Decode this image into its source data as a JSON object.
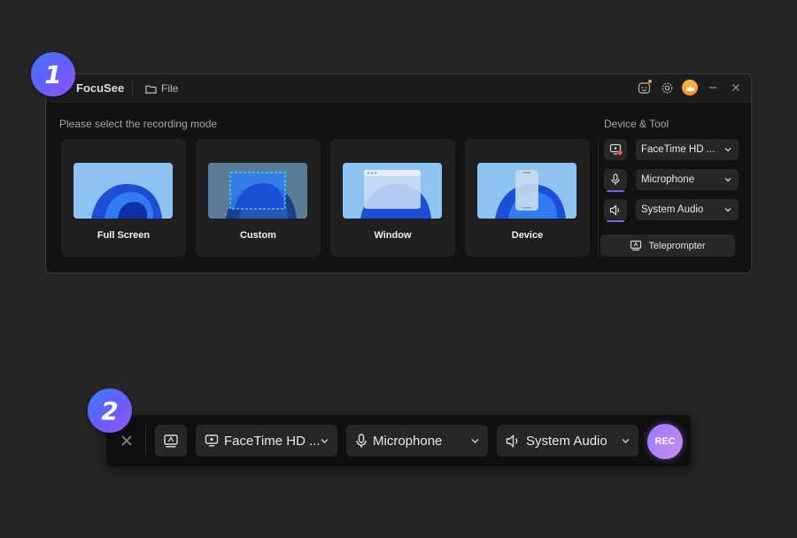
{
  "badges": {
    "first": "1",
    "second": "2"
  },
  "window": {
    "app_name": "FocuSee",
    "file_menu": "File",
    "title_icons": [
      "feedback-icon",
      "settings-icon",
      "crown-icon",
      "minimize-icon",
      "close-icon"
    ]
  },
  "recording": {
    "prompt": "Please select the recording mode",
    "modes": [
      {
        "label": "Full Screen",
        "icon": "fullscreen-thumbnail"
      },
      {
        "label": "Custom",
        "icon": "custom-region-thumbnail"
      },
      {
        "label": "Window",
        "icon": "window-thumbnail"
      },
      {
        "label": "Device",
        "icon": "device-thumbnail"
      }
    ]
  },
  "devices": {
    "heading": "Device & Tool",
    "camera": "FaceTime HD ...",
    "microphone": "Microphone",
    "audio": "System Audio",
    "teleprompter": "Teleprompter"
  },
  "toolbar": {
    "camera": "FaceTime HD ...",
    "microphone": "Microphone",
    "audio": "System Audio",
    "rec": "REC"
  },
  "colors": {
    "background": "#252525",
    "window": "#121212",
    "card": "#202020",
    "accent": "#6d63ff",
    "rec_gradient_start": "#9b78ff",
    "rec_gradient_end": "#c78bf0"
  }
}
